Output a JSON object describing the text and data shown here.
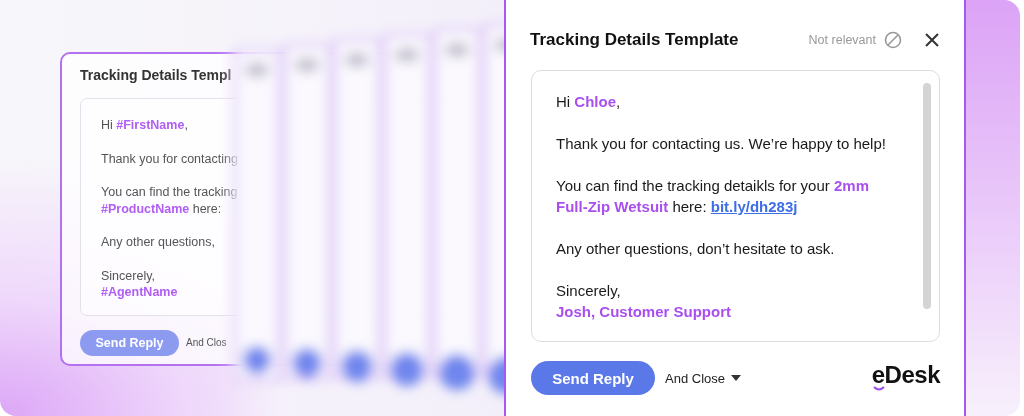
{
  "back_card": {
    "title": "Tracking Details Templ",
    "paragraphs": [
      [
        {
          "kind": "text",
          "text": "Hi "
        },
        {
          "kind": "highlight",
          "text": "#FirstName"
        },
        {
          "kind": "text",
          "text": ","
        }
      ],
      [
        {
          "kind": "text",
          "text": "Thank you for contacting"
        }
      ],
      [
        {
          "kind": "text",
          "text": "You can find the tracking"
        },
        {
          "kind": "break"
        },
        {
          "kind": "highlight",
          "text": "#ProductName"
        },
        {
          "kind": "text",
          "text": " here:"
        }
      ],
      [
        {
          "kind": "text",
          "text": "Any other questions,"
        }
      ],
      [
        {
          "kind": "text",
          "text": "Sincerely,"
        },
        {
          "kind": "break"
        },
        {
          "kind": "highlight",
          "text": "#AgentName"
        }
      ]
    ],
    "send_button": "Send Reply",
    "close_option": "And Clos"
  },
  "template_panel": {
    "title": "Tracking Details Template",
    "not_relevant": "Not relevant",
    "paragraphs": [
      [
        {
          "kind": "text",
          "text": "Hi "
        },
        {
          "kind": "highlight",
          "text": "Chloe"
        },
        {
          "kind": "text",
          "text": ","
        }
      ],
      [
        {
          "kind": "text",
          "text": "Thank you for contacting us. We’re happy to help!"
        }
      ],
      [
        {
          "kind": "text",
          "text": "You can find the tracking detaikls for your "
        },
        {
          "kind": "highlight",
          "text": "2mm"
        },
        {
          "kind": "break"
        },
        {
          "kind": "highlight",
          "text": "Full-Zip Wetsuit"
        },
        {
          "kind": "text",
          "text": " here: "
        },
        {
          "kind": "link",
          "text": "bit.ly/dh283j"
        }
      ],
      [
        {
          "kind": "text",
          "text": "Any other questions, don’t hesitate to ask."
        }
      ],
      [
        {
          "kind": "text",
          "text": "Sincerely,"
        },
        {
          "kind": "break"
        },
        {
          "kind": "highlight",
          "text": "Josh, Customer Support"
        }
      ]
    ],
    "send_button": "Send Reply",
    "close_option": "And Close",
    "logo": "eDesk"
  }
}
